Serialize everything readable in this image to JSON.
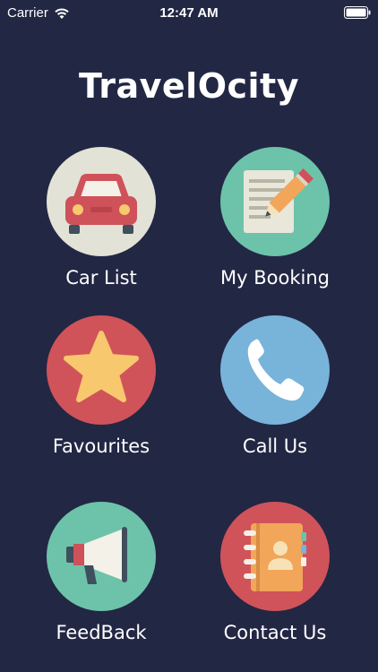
{
  "status_bar": {
    "carrier": "Carrier",
    "time": "12:47 AM"
  },
  "app": {
    "title": "TravelOcity"
  },
  "menu": {
    "items": [
      {
        "label": "Car List",
        "icon": "car-icon",
        "color": "#E3E2D6"
      },
      {
        "label": "My Booking",
        "icon": "booking-notepad-icon",
        "color": "#6DC3A9"
      },
      {
        "label": "Favourites",
        "icon": "star-icon",
        "color": "#D0535A"
      },
      {
        "label": "Call Us",
        "icon": "phone-icon",
        "color": "#78B3DA"
      },
      {
        "label": "FeedBack",
        "icon": "megaphone-icon",
        "color": "#6DC3A9"
      },
      {
        "label": "Contact Us",
        "icon": "address-book-icon",
        "color": "#D0535A"
      }
    ]
  },
  "colors": {
    "background": "#222744"
  }
}
